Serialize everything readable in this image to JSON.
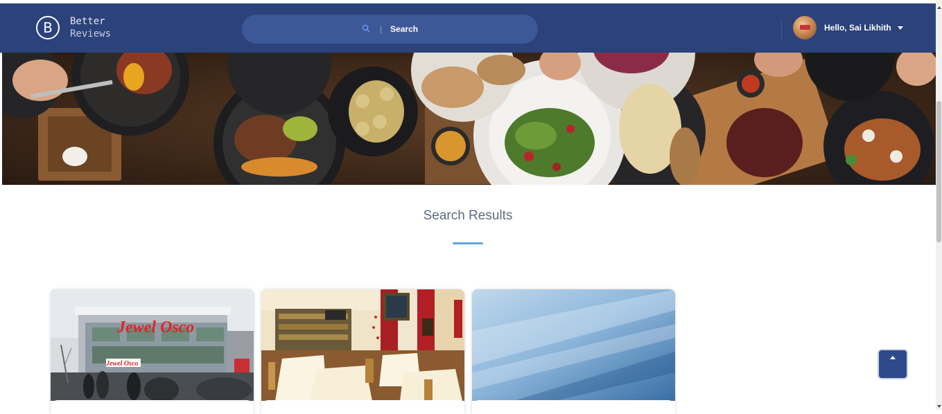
{
  "header": {
    "logo_letter": "B",
    "logo_line1": "Better",
    "logo_line2": "Reviews",
    "search": {
      "separator": "|",
      "label": "Search"
    },
    "user": {
      "greeting": "Hello, Sai Likhith"
    }
  },
  "main": {
    "section_title": "Search Results"
  },
  "colors": {
    "header_bg": "#2b427a",
    "search_bg": "#3d5897",
    "accent": "#5ba7e0"
  },
  "icons": {
    "search": "search-icon",
    "caret": "caret-down-icon",
    "scroll_top": "chevron-up-icon"
  }
}
